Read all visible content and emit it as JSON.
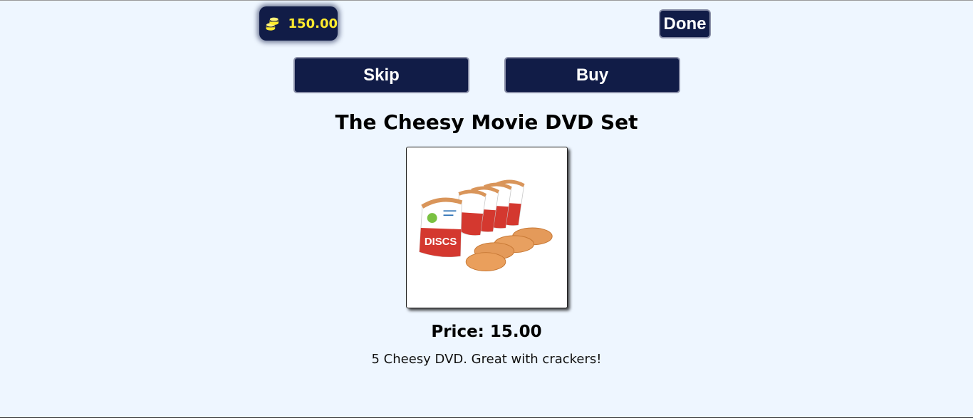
{
  "wallet": {
    "balance": "150.00",
    "icon": "coins-icon",
    "balance_color": "#ffea2e"
  },
  "header": {
    "done_label": "Done"
  },
  "actions": {
    "skip_label": "Skip",
    "buy_label": "Buy"
  },
  "product": {
    "title": "The Cheesy Movie DVD Set",
    "price_text": "Price: 15.00",
    "description": "5 Cheesy DVD. Great with crackers!",
    "image_icon": "cheese-discs-product-image",
    "package_label": "DISCS"
  },
  "theme": {
    "background": "#eef6ff",
    "button_bg": "#111c47",
    "button_text": "#ffffff"
  }
}
